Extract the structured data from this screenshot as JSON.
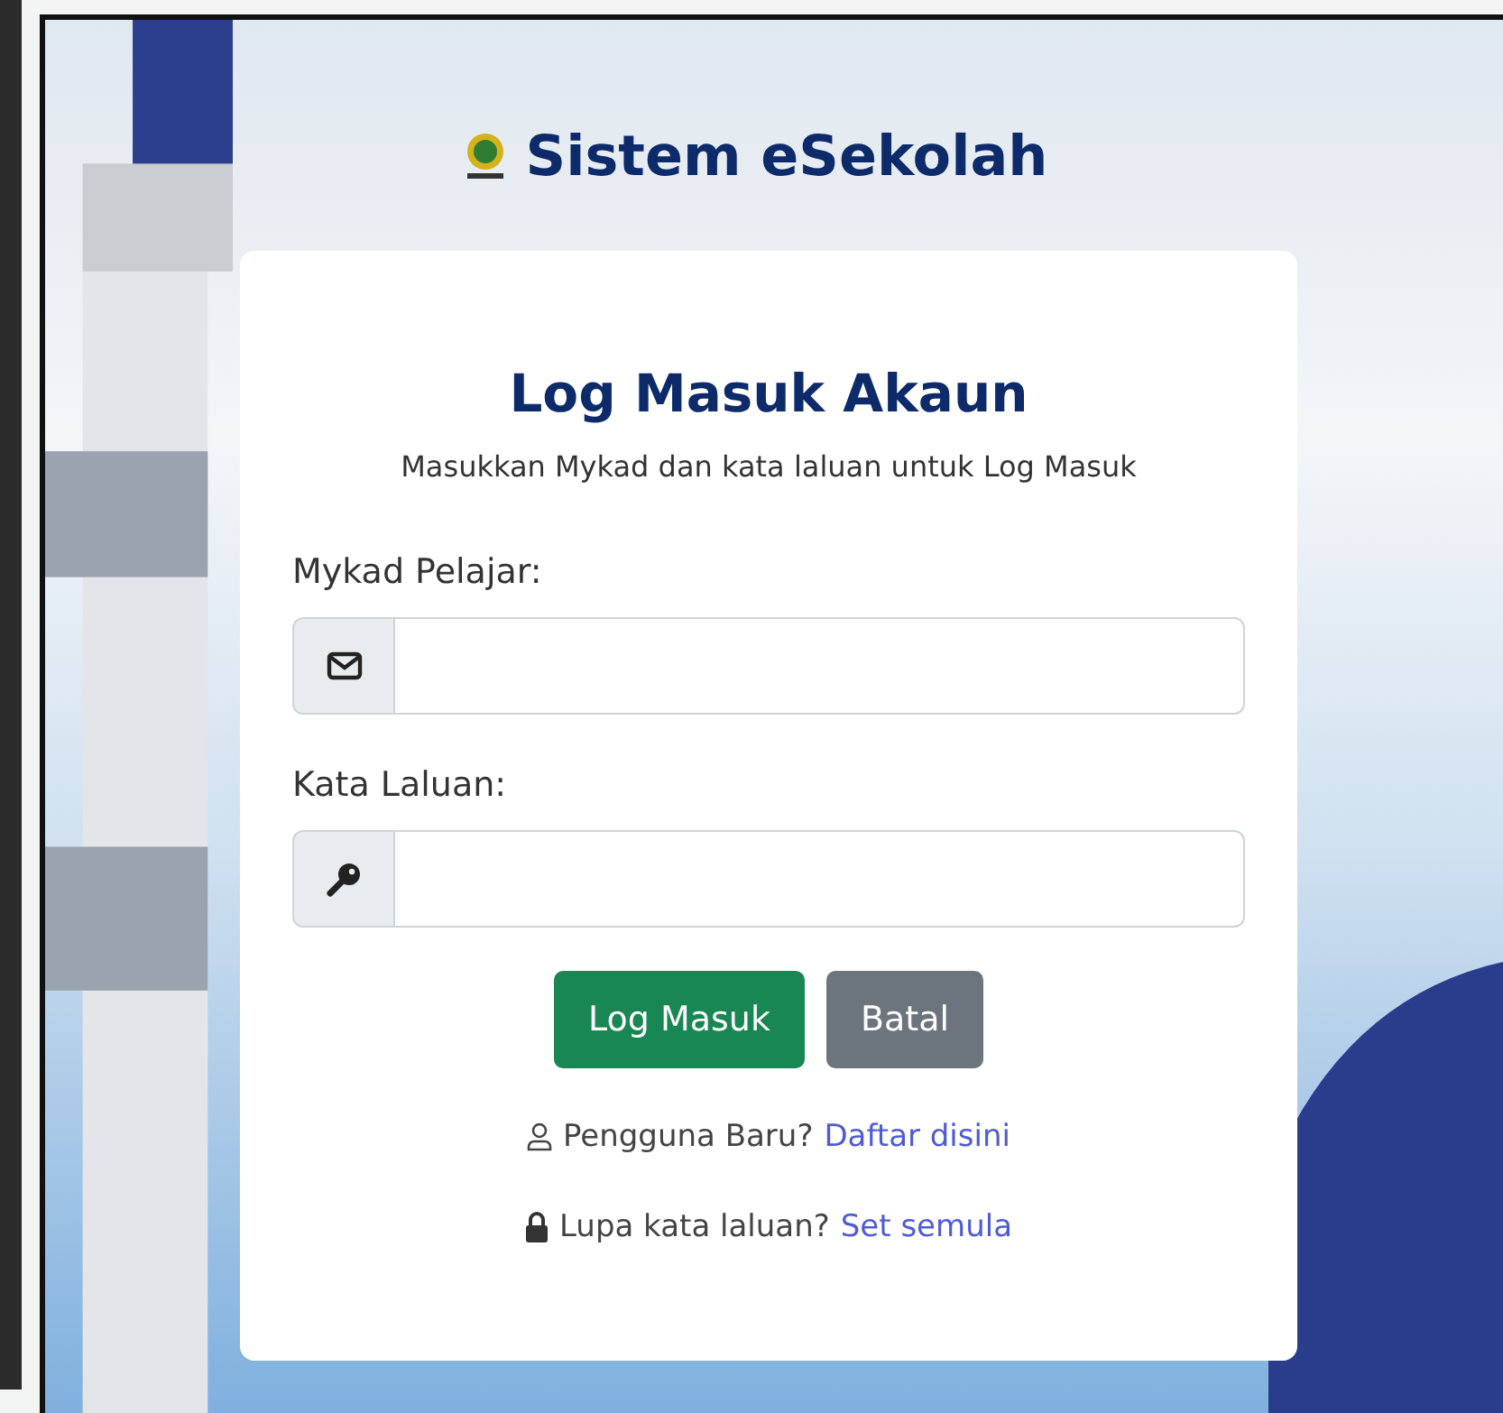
{
  "brand": {
    "title": "Sistem eSekolah"
  },
  "card": {
    "heading": "Log Masuk Akaun",
    "subtitle": "Masukkan Mykad dan kata laluan untuk Log Masuk",
    "fields": [
      {
        "label": "Mykad Pelajar:",
        "kind": "email"
      },
      {
        "label": "Kata Laluan:",
        "kind": "key"
      }
    ],
    "buttons": [
      {
        "label": "Log Masuk",
        "kind": "primary"
      },
      {
        "label": "Batal",
        "kind": "secondary"
      }
    ],
    "links": [
      {
        "kind": "user",
        "text": "Pengguna Baru?",
        "link": "Daftar disini"
      },
      {
        "kind": "lock",
        "text": "Lupa kata laluan?",
        "link": "Set semula"
      }
    ]
  }
}
